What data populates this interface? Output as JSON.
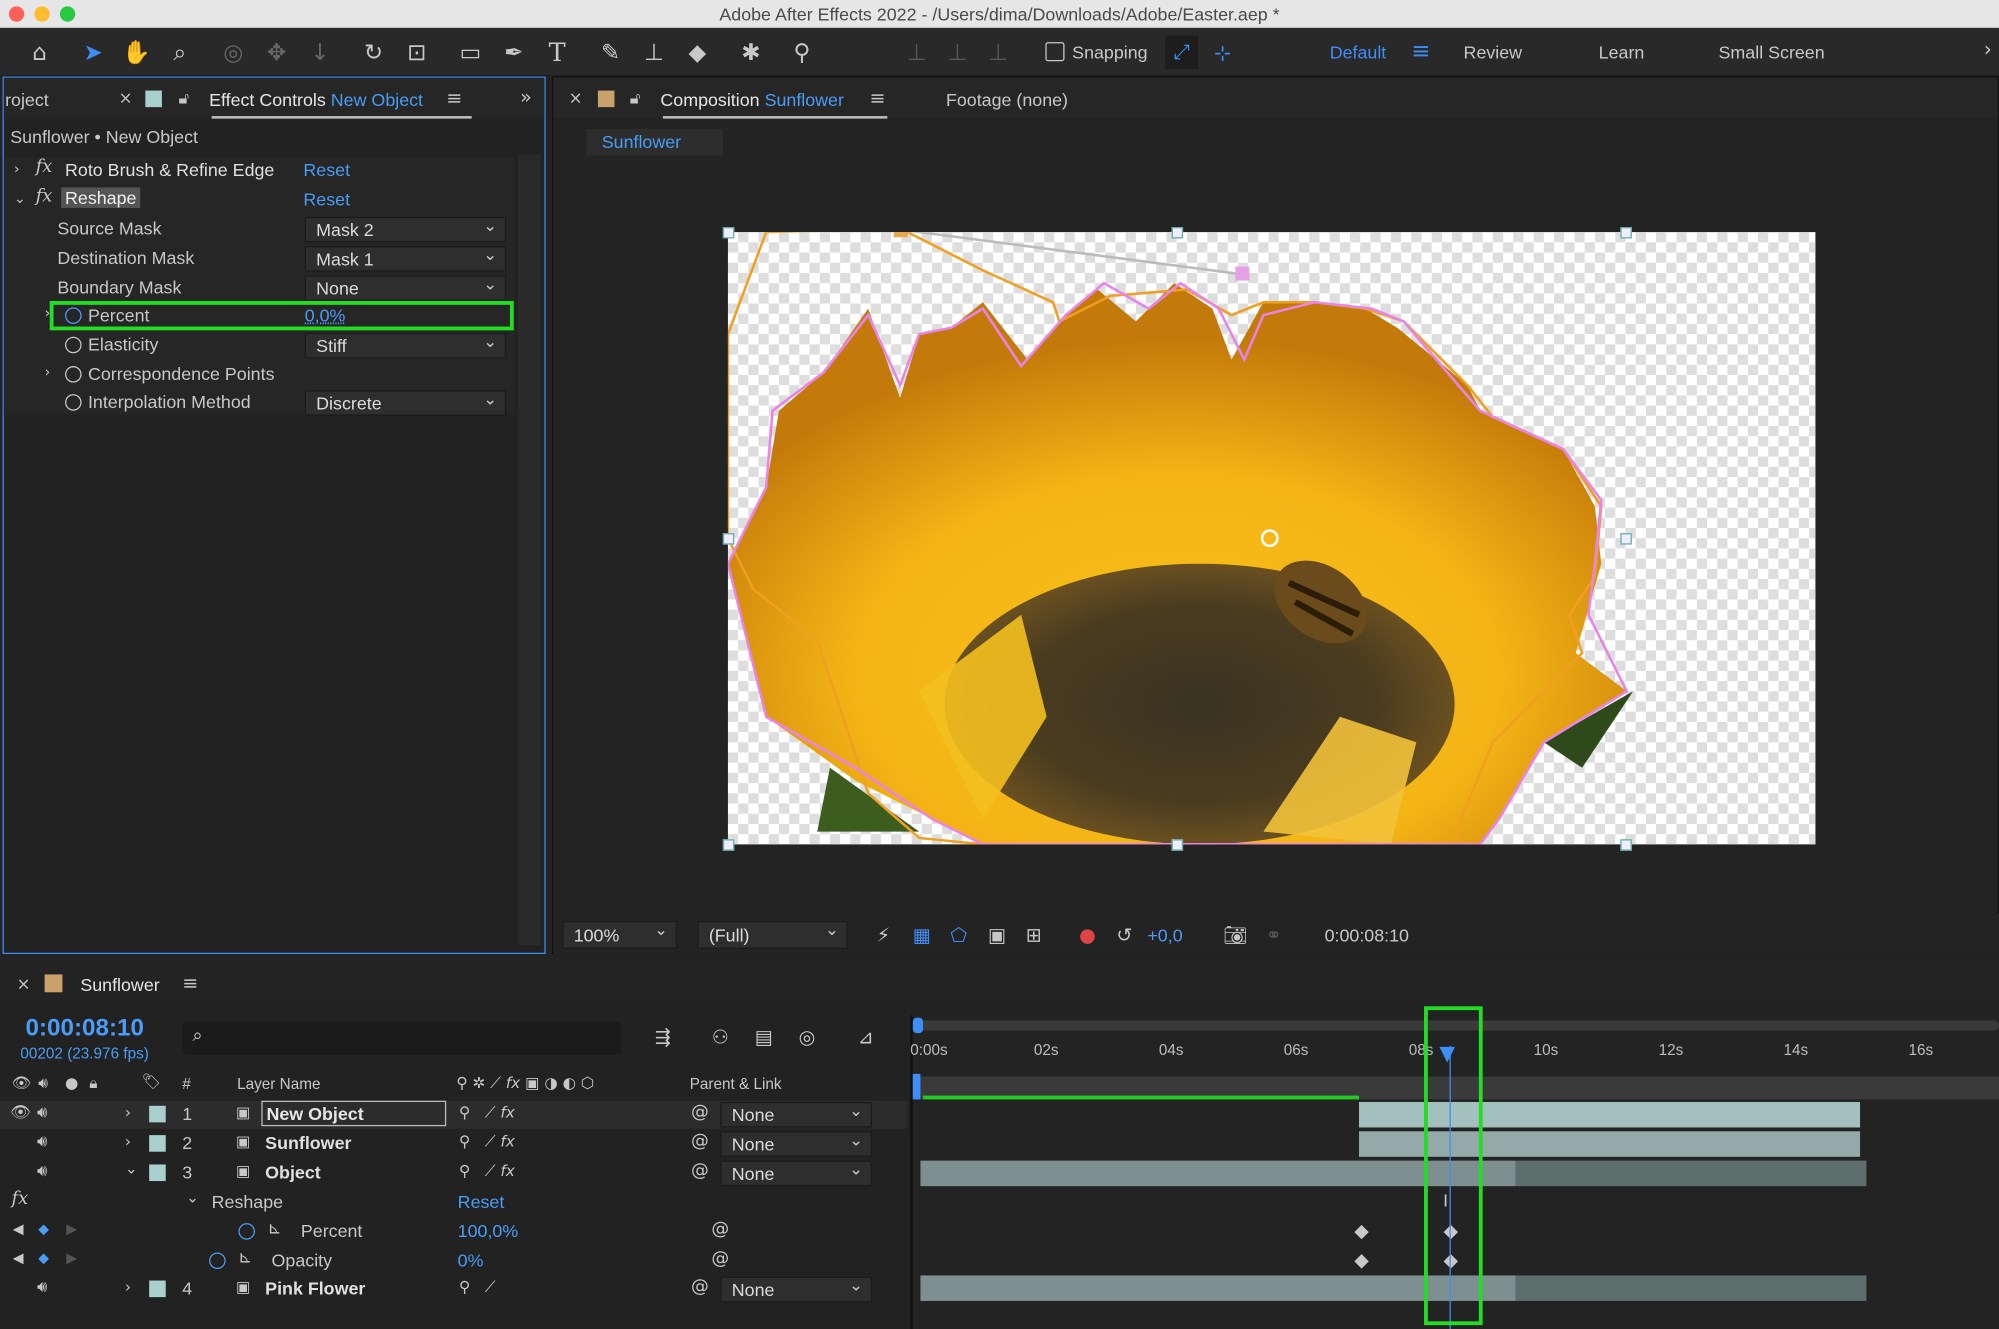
{
  "window": {
    "title": "Adobe After Effects 2022 - /Users/dima/Downloads/Adobe/Easter.aep *"
  },
  "toolbar": {
    "snapping_label": "Snapping",
    "workspaces": [
      "Default",
      "Review",
      "Learn",
      "Small Screen"
    ],
    "active_workspace": "Default"
  },
  "left_panel": {
    "project_tab": "roject",
    "tab_label": "Effect Controls",
    "tab_target": "New Object",
    "breadcrumb": "Sunflower • New Object",
    "effects": [
      {
        "name": "Roto Brush & Refine Edge",
        "reset": "Reset",
        "expanded": false
      },
      {
        "name": "Reshape",
        "reset": "Reset",
        "expanded": true
      }
    ],
    "properties": [
      {
        "label": "Source Mask",
        "value": "Mask 2"
      },
      {
        "label": "Destination Mask",
        "value": "Mask 1"
      },
      {
        "label": "Boundary Mask",
        "value": "None"
      }
    ],
    "percent": {
      "label": "Percent",
      "value": "0,0%"
    },
    "elasticity": {
      "label": "Elasticity",
      "value": "Stiff"
    },
    "correspondence": {
      "label": "Correspondence Points"
    },
    "interpolation": {
      "label": "Interpolation Method",
      "value": "Discrete"
    }
  },
  "comp_panel": {
    "tab_label": "Composition",
    "tab_target": "Sunflower",
    "footage_tab": "Footage (none)",
    "sub_tab": "Sunflower",
    "zoom": "100%",
    "resolution": "(Full)",
    "exposure": "+0,0",
    "timecode": "0:00:08:10"
  },
  "timeline": {
    "tab_label": "Sunflower",
    "current_time": "0:00:08:10",
    "frame_info": "00202 (23.976 fps)",
    "headers": {
      "num": "#",
      "layer_name": "Layer Name",
      "parent": "Parent & Link"
    },
    "ruler": [
      "0:00s",
      "02s",
      "04s",
      "06s",
      "08s",
      "10s",
      "12s",
      "14s",
      "16s"
    ],
    "layers": [
      {
        "num": "1",
        "name": "New Object",
        "parent": "None",
        "selected": true
      },
      {
        "num": "2",
        "name": "Sunflower",
        "parent": "None"
      },
      {
        "num": "3",
        "name": "Object",
        "parent": "None"
      }
    ],
    "sub_effect": {
      "name": "Reshape",
      "reset": "Reset"
    },
    "sub_props": [
      {
        "label": "Percent",
        "value": "100,0%"
      },
      {
        "label": "Opacity",
        "value": "0%"
      }
    ],
    "layer4": {
      "num": "4",
      "name": "Pink Flower",
      "parent": "None"
    }
  },
  "colors": {
    "accent": "#3d8ef7",
    "highlight": "#22dd22",
    "mask_orange": "#f0a020",
    "mask_pink": "#e884e8",
    "track": "#93aaa9"
  }
}
